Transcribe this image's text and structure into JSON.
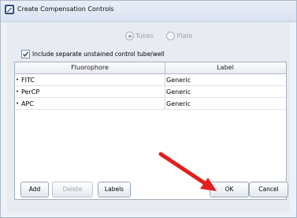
{
  "window": {
    "title": "Create Compensation Controls",
    "app_icon": "pencil-window-icon"
  },
  "mode": {
    "options": [
      {
        "label": "Tubes",
        "selected": true
      },
      {
        "label": "Plate",
        "selected": false
      }
    ],
    "enabled": false
  },
  "unstained_checkbox": {
    "label": "Include separate unstained control tube/well",
    "checked": true
  },
  "table": {
    "columns": [
      "Fluorophore",
      "Label"
    ],
    "rows": [
      {
        "marker": "•",
        "fluorophore": "FITC",
        "label": "Generic"
      },
      {
        "marker": "•",
        "fluorophore": "PerCP",
        "label": "Generic"
      },
      {
        "marker": "•",
        "fluorophore": "APC",
        "label": "Generic"
      }
    ]
  },
  "buttons": {
    "add": "Add",
    "delete": "Delete",
    "labels": "Labels",
    "ok": "OK",
    "cancel": "Cancel"
  },
  "annotation": {
    "arrow_color": "#e21f1f",
    "points_to": "OK"
  }
}
